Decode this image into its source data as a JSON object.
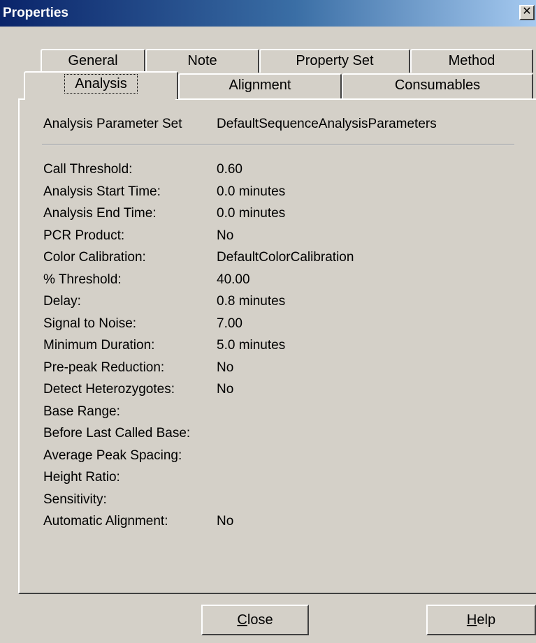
{
  "window": {
    "title": "Properties",
    "close_glyph": "✕"
  },
  "tabs": {
    "back_row": [
      {
        "label": "General"
      },
      {
        "label": "Note"
      },
      {
        "label": "Property Set"
      },
      {
        "label": "Method"
      }
    ],
    "front_row": [
      {
        "label": "Analysis",
        "selected": true
      },
      {
        "label": "Alignment"
      },
      {
        "label": "Consumables"
      }
    ]
  },
  "analysis": {
    "parameter_set_label": "Analysis Parameter Set",
    "parameter_set_value": "DefaultSequenceAnalysisParameters",
    "rows": [
      {
        "label": "Call Threshold:",
        "value": "0.60"
      },
      {
        "label": "Analysis Start Time:",
        "value": "0.0 minutes"
      },
      {
        "label": "Analysis End Time:",
        "value": "0.0 minutes"
      },
      {
        "label": "PCR Product:",
        "value": "No"
      },
      {
        "label": "Color Calibration:",
        "value": "DefaultColorCalibration"
      },
      {
        "label": "% Threshold:",
        "value": "40.00"
      },
      {
        "label": "Delay:",
        "value": "0.8 minutes"
      },
      {
        "label": "Signal to Noise:",
        "value": "7.00"
      },
      {
        "label": "Minimum Duration:",
        "value": "5.0 minutes"
      },
      {
        "label": "Pre-peak Reduction:",
        "value": "No"
      },
      {
        "label": "Detect Heterozygotes:",
        "value": "No"
      },
      {
        "label": "Base Range:",
        "value": ""
      },
      {
        "label": "Before Last Called Base:",
        "value": ""
      },
      {
        "label": "Average Peak Spacing:",
        "value": ""
      },
      {
        "label": "Height Ratio:",
        "value": ""
      },
      {
        "label": "Sensitivity:",
        "value": ""
      },
      {
        "label": "Automatic Alignment:",
        "value": "No"
      }
    ]
  },
  "buttons": {
    "close_first": "C",
    "close_rest": "lose",
    "help_first": "H",
    "help_rest": "elp"
  }
}
